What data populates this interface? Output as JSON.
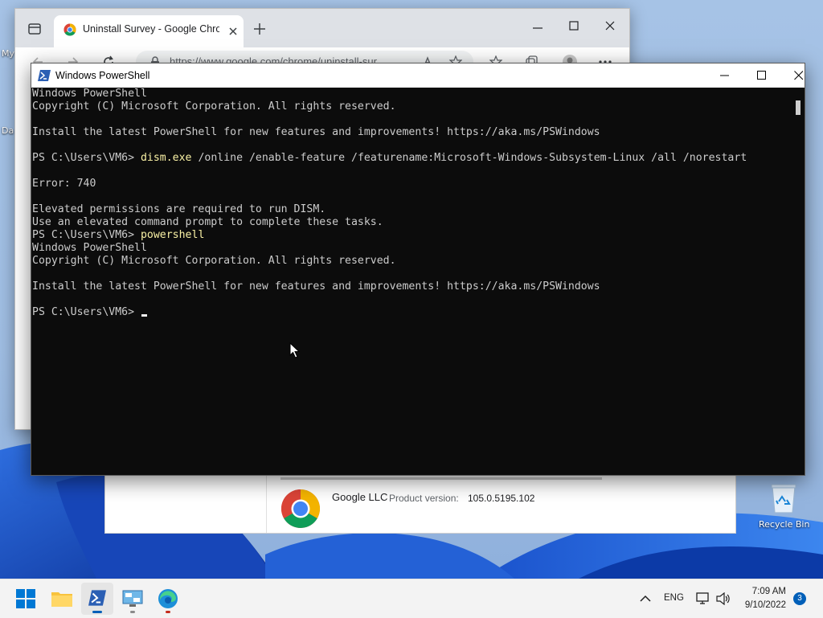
{
  "desktop": {
    "left_labels": [
      "My",
      "Da"
    ],
    "recycle_bin_label": "Recycle Bin"
  },
  "chrome": {
    "tab_title": "Uninstall Survey - Google Chrome",
    "url": "https://www.google.com/chrome/uninstall-sur..."
  },
  "survey": {
    "publisher": "Google LLC",
    "version_label": "Product version:",
    "version_value": "105.0.5195.102"
  },
  "powershell": {
    "title": "Windows PowerShell",
    "lines": [
      {
        "text": "Windows PowerShell"
      },
      {
        "text": "Copyright (C) Microsoft Corporation. All rights reserved."
      },
      {
        "text": ""
      },
      {
        "text": "Install the latest PowerShell for new features and improvements! https://aka.ms/PSWindows"
      },
      {
        "text": ""
      },
      {
        "prompt": "PS C:\\Users\\VM6> ",
        "cmd": "dism.exe",
        "args": " /online /enable-feature /featurename:Microsoft-Windows-Subsystem-Linux /all /norestart"
      },
      {
        "text": ""
      },
      {
        "text": "Error: 740"
      },
      {
        "text": ""
      },
      {
        "text": "Elevated permissions are required to run DISM."
      },
      {
        "text": "Use an elevated command prompt to complete these tasks."
      },
      {
        "prompt": "PS C:\\Users\\VM6> ",
        "cmd": "powershell",
        "args": ""
      },
      {
        "text": "Windows PowerShell"
      },
      {
        "text": "Copyright (C) Microsoft Corporation. All rights reserved."
      },
      {
        "text": ""
      },
      {
        "text": "Install the latest PowerShell for new features and improvements! https://aka.ms/PSWindows"
      },
      {
        "text": ""
      },
      {
        "prompt": "PS C:\\Users\\VM6> ",
        "cmd": "",
        "args": ""
      }
    ]
  },
  "taskbar": {
    "language": "ENG",
    "time": "7:09 AM",
    "date": "9/10/2022",
    "notification_count": "3"
  },
  "colors": {
    "console_bg": "#0c0c0c",
    "console_fg": "#cccccc",
    "command_color": "#f9f1a5",
    "accent": "#005fb8"
  }
}
